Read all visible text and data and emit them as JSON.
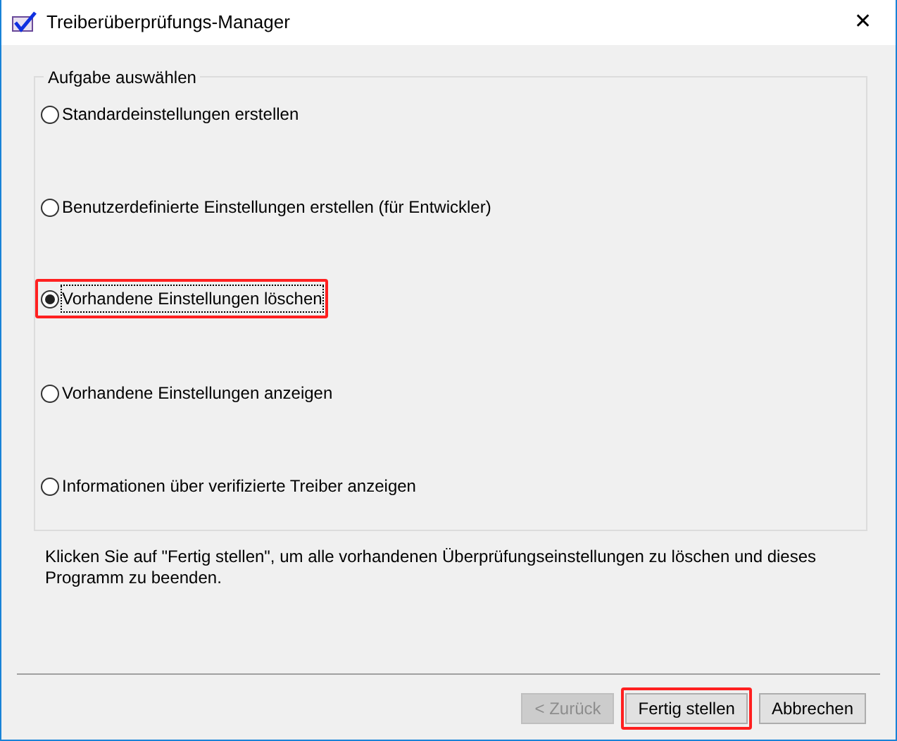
{
  "window": {
    "title": "Treiberüberprüfungs-Manager",
    "close": "✕"
  },
  "group": {
    "title": "Aufgabe auswählen",
    "options": [
      {
        "label": "Standardeinstellungen erstellen",
        "selected": false,
        "highlighted": false
      },
      {
        "label": "Benutzerdefinierte Einstellungen erstellen (für Entwickler)",
        "selected": false,
        "highlighted": false
      },
      {
        "label": "Vorhandene Einstellungen löschen",
        "selected": true,
        "highlighted": true
      },
      {
        "label": "Vorhandene Einstellungen anzeigen",
        "selected": false,
        "highlighted": false
      },
      {
        "label": "Informationen über verifizierte Treiber anzeigen",
        "selected": false,
        "highlighted": false
      }
    ]
  },
  "description": "Klicken Sie auf \"Fertig stellen\", um alle vorhandenen Überprüfungseinstellungen zu löschen und dieses Programm zu beenden.",
  "buttons": [
    {
      "label": "< Zurück",
      "disabled": true,
      "highlighted": false
    },
    {
      "label": "Fertig stellen",
      "disabled": false,
      "highlighted": true
    },
    {
      "label": "Abbrechen",
      "disabled": false,
      "highlighted": false
    }
  ]
}
